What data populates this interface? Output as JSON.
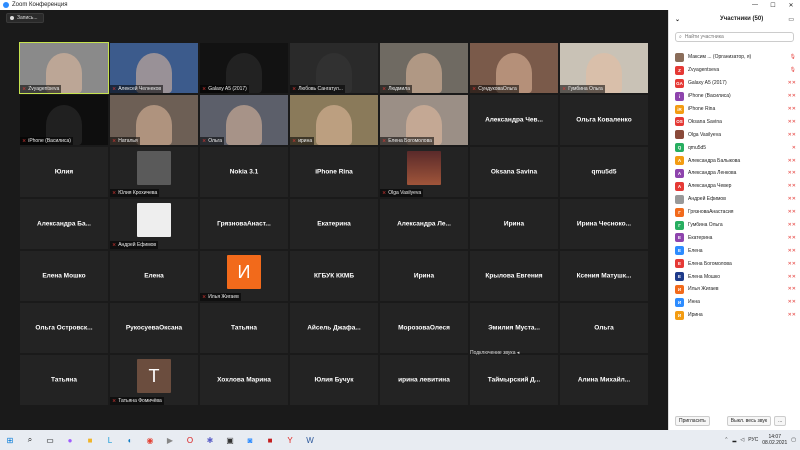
{
  "titlebar": {
    "title": "Zoom Конференция"
  },
  "toolbar": {
    "record_label": "Запись..."
  },
  "tiles": [
    {
      "name": "Zvyagentseva",
      "type": "video",
      "active": true,
      "bg": "#8a8a8a"
    },
    {
      "name": "Алексей Челнеков",
      "type": "video",
      "bg": "#3c5b8c"
    },
    {
      "name": "Galaxy A5 (2017)",
      "type": "video",
      "bg": "#121212"
    },
    {
      "name": "Любовь Сангатул...",
      "type": "video",
      "bg": "#2a2a2a"
    },
    {
      "name": "Людмила",
      "type": "video",
      "bg": "#6f6a62"
    },
    {
      "name": "СундуковаОльга",
      "type": "video",
      "bg": "#7a5a4a"
    },
    {
      "name": "Гумбина Ольга",
      "type": "video",
      "bg": "#c9c2b6"
    },
    {
      "name": "iPhone (Василиса)",
      "type": "video",
      "bg": "#0e0e0e"
    },
    {
      "name": "Наталья",
      "type": "video",
      "bg": "#6d5f55"
    },
    {
      "name": "Ольга",
      "type": "video",
      "bg": "#5c5f6a"
    },
    {
      "name": "ирина",
      "type": "video",
      "bg": "#8a7a5a"
    },
    {
      "name": "Елена Богомолова",
      "type": "video",
      "bg": "#9b8f86"
    },
    {
      "name": "Александра Чев...",
      "type": "text"
    },
    {
      "name": "Ольга Коваленко",
      "type": "text"
    },
    {
      "name": "Юлия",
      "type": "text"
    },
    {
      "name": "Юлия Крохичева",
      "type": "blur"
    },
    {
      "name": "Nokia 3.1",
      "type": "text"
    },
    {
      "name": "iPhone Rina",
      "type": "text"
    },
    {
      "name": "Olga Vasilyeva",
      "type": "photo"
    },
    {
      "name": "Oksana Savina",
      "type": "text"
    },
    {
      "name": "qmu5d5",
      "type": "text"
    },
    {
      "name": "Александра Ба...",
      "type": "text"
    },
    {
      "name": "Андрей Ефимов",
      "type": "sketch"
    },
    {
      "name": "ГрязноваАнаст...",
      "type": "text"
    },
    {
      "name": "Екатерина",
      "type": "text"
    },
    {
      "name": "Александра Ле...",
      "type": "text"
    },
    {
      "name": "Ирина",
      "type": "text"
    },
    {
      "name": "Ирина Чесноко...",
      "type": "text"
    },
    {
      "name": "Елена Мошко",
      "type": "text"
    },
    {
      "name": "Елена",
      "type": "text"
    },
    {
      "name": "Илья Жигаев",
      "type": "letter",
      "letter": "И",
      "color": "#f26a1b"
    },
    {
      "name": "КГБУК ККМБ",
      "type": "text"
    },
    {
      "name": "Ирина",
      "type": "text"
    },
    {
      "name": "Крылова Евгения",
      "type": "text"
    },
    {
      "name": "Ксения Матушк...",
      "type": "text"
    },
    {
      "name": "Ольга Островск...",
      "type": "text"
    },
    {
      "name": "РукосуеваОксана",
      "type": "text"
    },
    {
      "name": "Татьяна",
      "type": "text"
    },
    {
      "name": "Айсель Джафа...",
      "type": "text"
    },
    {
      "name": "МорозоваОлеся",
      "type": "text"
    },
    {
      "name": "Эмилия Муста...",
      "type": "text"
    },
    {
      "name": "Ольга",
      "type": "text"
    },
    {
      "name": "Татьяна",
      "type": "text"
    },
    {
      "name": "Татьяна Фомичёва",
      "type": "letter",
      "letter": "Т",
      "color": "#6b4d3e"
    },
    {
      "name": "Хохлова Марина",
      "type": "text"
    },
    {
      "name": "Юлия Бучук",
      "type": "text"
    },
    {
      "name": "ирина левитина",
      "type": "text"
    },
    {
      "name": "Таймырский Д...",
      "type": "text"
    },
    {
      "name": "Алина Михайл...",
      "type": "text"
    }
  ],
  "connect_audio_text": "Подключение звука",
  "panel": {
    "title": "Участники (50)",
    "search_placeholder": "Найти участника",
    "participants": [
      {
        "initials": "",
        "name": "Максим ... (Организатор, я)",
        "color": "#8a6d5a",
        "icons": "🎙"
      },
      {
        "initials": "Z",
        "name": "Zvyagentseva",
        "color": "#e53935",
        "icons": "🎙"
      },
      {
        "initials": "GA",
        "name": "Galaxy A5 (2017)",
        "color": "#e53935",
        "icons": "✕✕"
      },
      {
        "initials": "i",
        "name": "iPhone (Василиса)",
        "color": "#8e44ad",
        "icons": "✕✕"
      },
      {
        "initials": "iR",
        "name": "iPhone Rina",
        "color": "#f39c12",
        "icons": "✕✕"
      },
      {
        "initials": "OS",
        "name": "Oksana Savina",
        "color": "#e53935",
        "icons": "✕✕"
      },
      {
        "initials": "",
        "name": "Olga Vasilyeva",
        "color": "#8a4a3a",
        "icons": "✕✕"
      },
      {
        "initials": "Q",
        "name": "qmu5d5",
        "color": "#27ae60",
        "icons": "✕"
      },
      {
        "initials": "А",
        "name": "Александра Балыкова",
        "color": "#f39c12",
        "icons": "✕✕"
      },
      {
        "initials": "А",
        "name": "Александра Ленкова",
        "color": "#8e44ad",
        "icons": "✕✕"
      },
      {
        "initials": "А",
        "name": "Александра Чевер",
        "color": "#e53935",
        "icons": "✕✕"
      },
      {
        "initials": "",
        "name": "Андрей Ефимов",
        "color": "#999999",
        "icons": "✕✕"
      },
      {
        "initials": "Г",
        "name": "ГрязноваАнастасия",
        "color": "#f26a1b",
        "icons": "✕✕"
      },
      {
        "initials": "Г",
        "name": "Гумбина Ольга",
        "color": "#27ae60",
        "icons": "✕✕"
      },
      {
        "initials": "Е",
        "name": "Екатерина",
        "color": "#8e44ad",
        "icons": "✕✕"
      },
      {
        "initials": "Е",
        "name": "Елена",
        "color": "#2d8cff",
        "icons": "✕✕"
      },
      {
        "initials": "Е",
        "name": "Елена Богомолова",
        "color": "#e53935",
        "icons": "✕✕"
      },
      {
        "initials": "Е",
        "name": "Елена Мошко",
        "color": "#1e3a8a",
        "icons": "✕✕"
      },
      {
        "initials": "И",
        "name": "Илья Жигаев",
        "color": "#f26a1b",
        "icons": "✕✕"
      },
      {
        "initials": "И",
        "name": "Инна",
        "color": "#2d8cff",
        "icons": "✕✕"
      },
      {
        "initials": "И",
        "name": "Ирина",
        "color": "#f39c12",
        "icons": "✕✕"
      }
    ],
    "invite_label": "Пригласить",
    "mute_all_label": "Выкл. весь звук",
    "more_label": "..."
  },
  "taskbar": {
    "lang": "РУС",
    "time": "14:07",
    "date": "08.02.2021"
  }
}
